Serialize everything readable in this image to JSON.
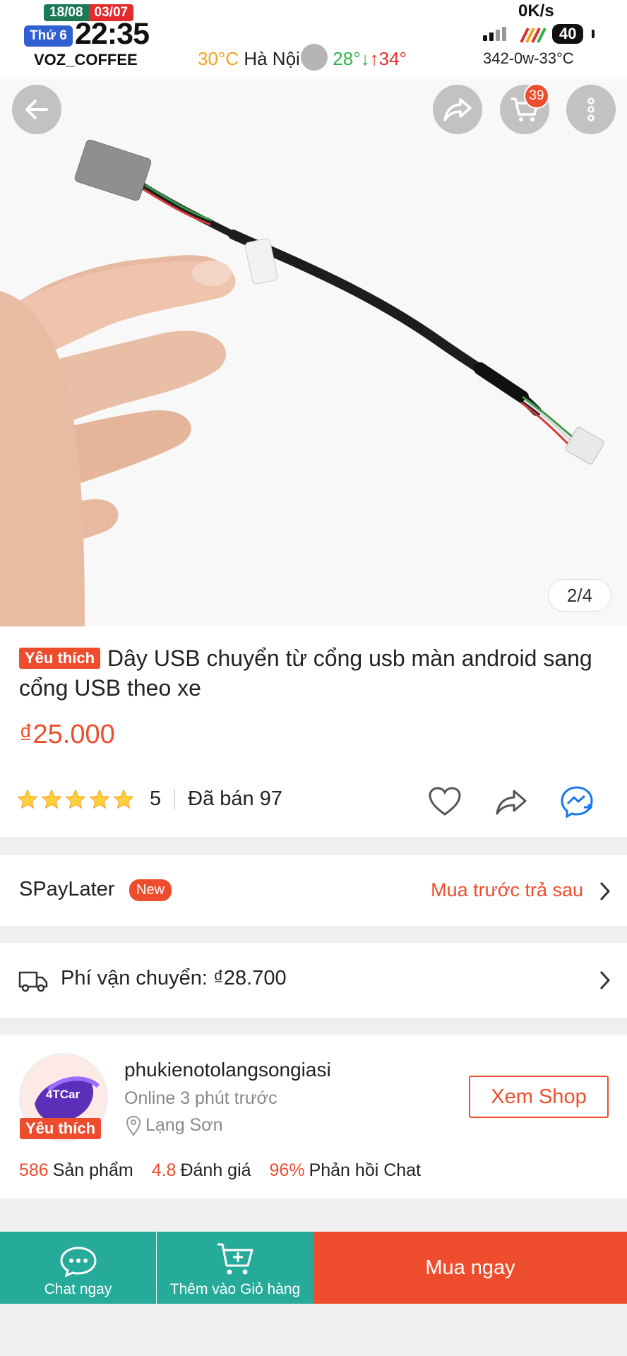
{
  "status_bar": {
    "date_solar": "18/08",
    "date_lunar": "03/07",
    "weekday": "Thứ 6",
    "time": "22:35",
    "label": "VOZ_COFFEE",
    "weather_temp": "30°C",
    "weather_city": "Hà Nội",
    "weather_range": "28°↓",
    "weather_max": "↑34°",
    "net_speed": "0K/s",
    "battery": "40",
    "sys_info": "342-0w-33°C"
  },
  "header": {
    "cart_count": "39",
    "image_pager": "2/4"
  },
  "product": {
    "favorite_tag": "Yêu thích",
    "title": "Dây USB chuyển từ cổng usb màn android sang cổng USB theo xe",
    "price": "₫25.000",
    "rating": "5",
    "rating_stars": 5,
    "sold": "Đã bán 97"
  },
  "spaylater": {
    "label": "SPayLater",
    "badge": "New",
    "link": "Mua trước trả sau"
  },
  "shipping": {
    "label": "Phí vận chuyển: ₫28.700"
  },
  "shop": {
    "name": "phukienotolangsongiasi",
    "online": "Online 3 phút trước",
    "location": "Lạng Sơn",
    "favorite_tag": "Yêu thích",
    "avatar_text": "4TCar",
    "view_button": "Xem Shop",
    "stats": {
      "products_value": "586",
      "products_label": "Sản phẩm",
      "rating_value": "4.8",
      "rating_label": "Đánh giá",
      "response_value": "96%",
      "response_label": "Phản hồi Chat"
    }
  },
  "bottom_bar": {
    "chat": "Chat ngay",
    "add_to_cart": "Thêm vào Giỏ hàng",
    "buy_now": "Mua ngay"
  },
  "colors": {
    "accent": "#ee4d2d",
    "teal": "#26aa99"
  }
}
